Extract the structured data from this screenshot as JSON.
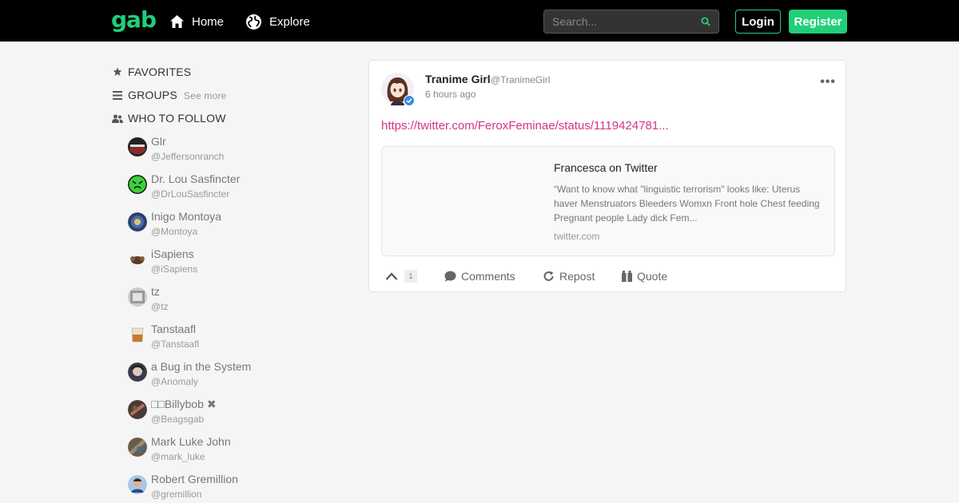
{
  "header": {
    "logo": "gab",
    "nav": [
      {
        "label": "Home",
        "icon": "home-icon"
      },
      {
        "label": "Explore",
        "icon": "globe-icon"
      }
    ],
    "search_placeholder": "Search...",
    "login_label": "Login",
    "register_label": "Register",
    "brand_color": "#21cf7a"
  },
  "sidebar": {
    "favorites_label": "FAVORITES",
    "groups_label": "GROUPS",
    "groups_see_more": "See more",
    "who_to_follow_label": "WHO TO FOLLOW",
    "follow": [
      {
        "name": "Glr",
        "handle": "@Jeffersonranch"
      },
      {
        "name": "Dr. Lou Sasfincter",
        "handle": "@DrLouSasfincter"
      },
      {
        "name": "Inigo Montoya",
        "handle": "@Montoya"
      },
      {
        "name": "iSapiens",
        "handle": "@iSapiens"
      },
      {
        "name": "tz",
        "handle": "@tz"
      },
      {
        "name": "Tanstaafl",
        "handle": "@Tanstaafl"
      },
      {
        "name": "a Bug in the System",
        "handle": "@Anomaly"
      },
      {
        "name": "□□Billybob ✖",
        "handle": "@Beagsgab"
      },
      {
        "name": "Mark Luke John",
        "handle": "@mark_luke"
      },
      {
        "name": "Robert Gremillion",
        "handle": "@gremillion"
      }
    ]
  },
  "post": {
    "author_name": "Tranime Girl",
    "author_handle": "@TranimeGirl",
    "time": "6 hours ago",
    "more": "•••",
    "link": "https://twitter.com/FeroxFeminae/status/1119424781...",
    "embed": {
      "title": "Francesca on Twitter",
      "description": "“Want to know what \"linguistic terrorism\" looks like: Uterus haver Menstruators Bleeders Womxn Front hole Chest feeding Pregnant people Lady dick Fem...",
      "domain": "twitter.com"
    },
    "actions": {
      "upvote_count": "1",
      "comments_label": "Comments",
      "repost_label": "Repost",
      "quote_label": "Quote"
    },
    "link_color": "#d63384"
  }
}
